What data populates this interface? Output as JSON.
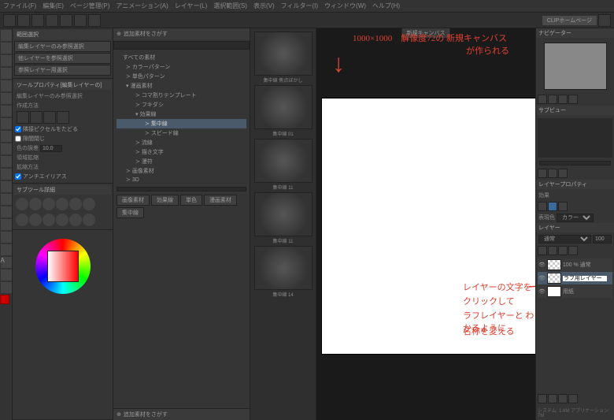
{
  "menu": [
    "ファイル(F)",
    "編集(E)",
    "ページ管理(P)",
    "アニメーション(A)",
    "レイヤー(L)",
    "選択範囲(S)",
    "表示(V)",
    "フィルター(I)",
    "ウィンドウ(W)",
    "ヘルプ(H)"
  ],
  "toolbar_label": "CLIPホームページ",
  "tab_title": "新規キャンバス",
  "nav_panel": {
    "title": "範囲選択",
    "btn1": "編集レイヤーのみ参照選択",
    "btn2": "他レイヤーを参照選択",
    "btn3": "参照レイヤー用選択"
  },
  "tool_prop": {
    "title": "ツールプロパティ[編集レイヤーの]",
    "subtitle": "編集レイヤーのみ参照選択",
    "mode_label": "作成方法",
    "chk1": "隣接ピクセルをたどる",
    "chk2": "隙間閉じ",
    "col_lbl": "色の誤差",
    "col_val": "10.0",
    "area_lbl": "領域拡縮",
    "fill_lbl": "拡縮方法",
    "aa": "アンチエイリアス"
  },
  "subtool": {
    "title": "サブツール詳細"
  },
  "material": {
    "header": "追加素材をさがす",
    "search_placeholder": "",
    "tree": [
      {
        "label": "すべての素材",
        "lvl": 0
      },
      {
        "label": "カラーパターン",
        "lvl": 1
      },
      {
        "label": "単色パターン",
        "lvl": 1
      },
      {
        "label": "漫画素材",
        "lvl": 1,
        "exp": true
      },
      {
        "label": "コマ割りテンプレート",
        "lvl": 2
      },
      {
        "label": "フキダシ",
        "lvl": 2
      },
      {
        "label": "効果線",
        "lvl": 2,
        "exp": true
      },
      {
        "label": "集中線",
        "lvl": 3,
        "sel": true
      },
      {
        "label": "スピード線",
        "lvl": 3
      },
      {
        "label": "流線",
        "lvl": 2
      },
      {
        "label": "描き文字",
        "lvl": 2
      },
      {
        "label": "漫符",
        "lvl": 2
      },
      {
        "label": "画像素材",
        "lvl": 1
      },
      {
        "label": "3D",
        "lvl": 1
      }
    ],
    "thumbs": [
      "集中線 焦点ぼかし",
      "",
      "集中線 01",
      "",
      "集中線 11",
      "",
      "集中線 11",
      "",
      "集中線 14",
      ""
    ],
    "btns": [
      "画像素材",
      "効果線",
      "単色",
      "漫画素材",
      "集中線"
    ],
    "footer": "追加素材をさがす"
  },
  "navigator": {
    "title": "ナビゲーター"
  },
  "subview": {
    "title": "サブビュー"
  },
  "layer_prop": {
    "title": "レイヤープロパティ",
    "effect": "効果",
    "express": "表現色",
    "color_mode": "カラー"
  },
  "layers": {
    "title": "レイヤー",
    "blend": "通常",
    "opacity": "100",
    "list": [
      {
        "name": "100 % 通常",
        "sel": false,
        "thumb": "check"
      },
      {
        "name": "ラフ用レイヤー",
        "sel": true,
        "thumb": "check",
        "editable": true
      },
      {
        "name": "用紙",
        "sel": false,
        "thumb": "white"
      }
    ]
  },
  "status": "システム: 1.6M  アプリケーション: 7M",
  "annotations": {
    "a1": "1000×1000　解像度72の 新規キャンバス",
    "a2": "が作られる",
    "a3": "↓",
    "a4": "レイヤーの文字を",
    "a5": "クリックして",
    "a6": "ラフレイヤーと わかるように",
    "a7": "名称を変える"
  }
}
